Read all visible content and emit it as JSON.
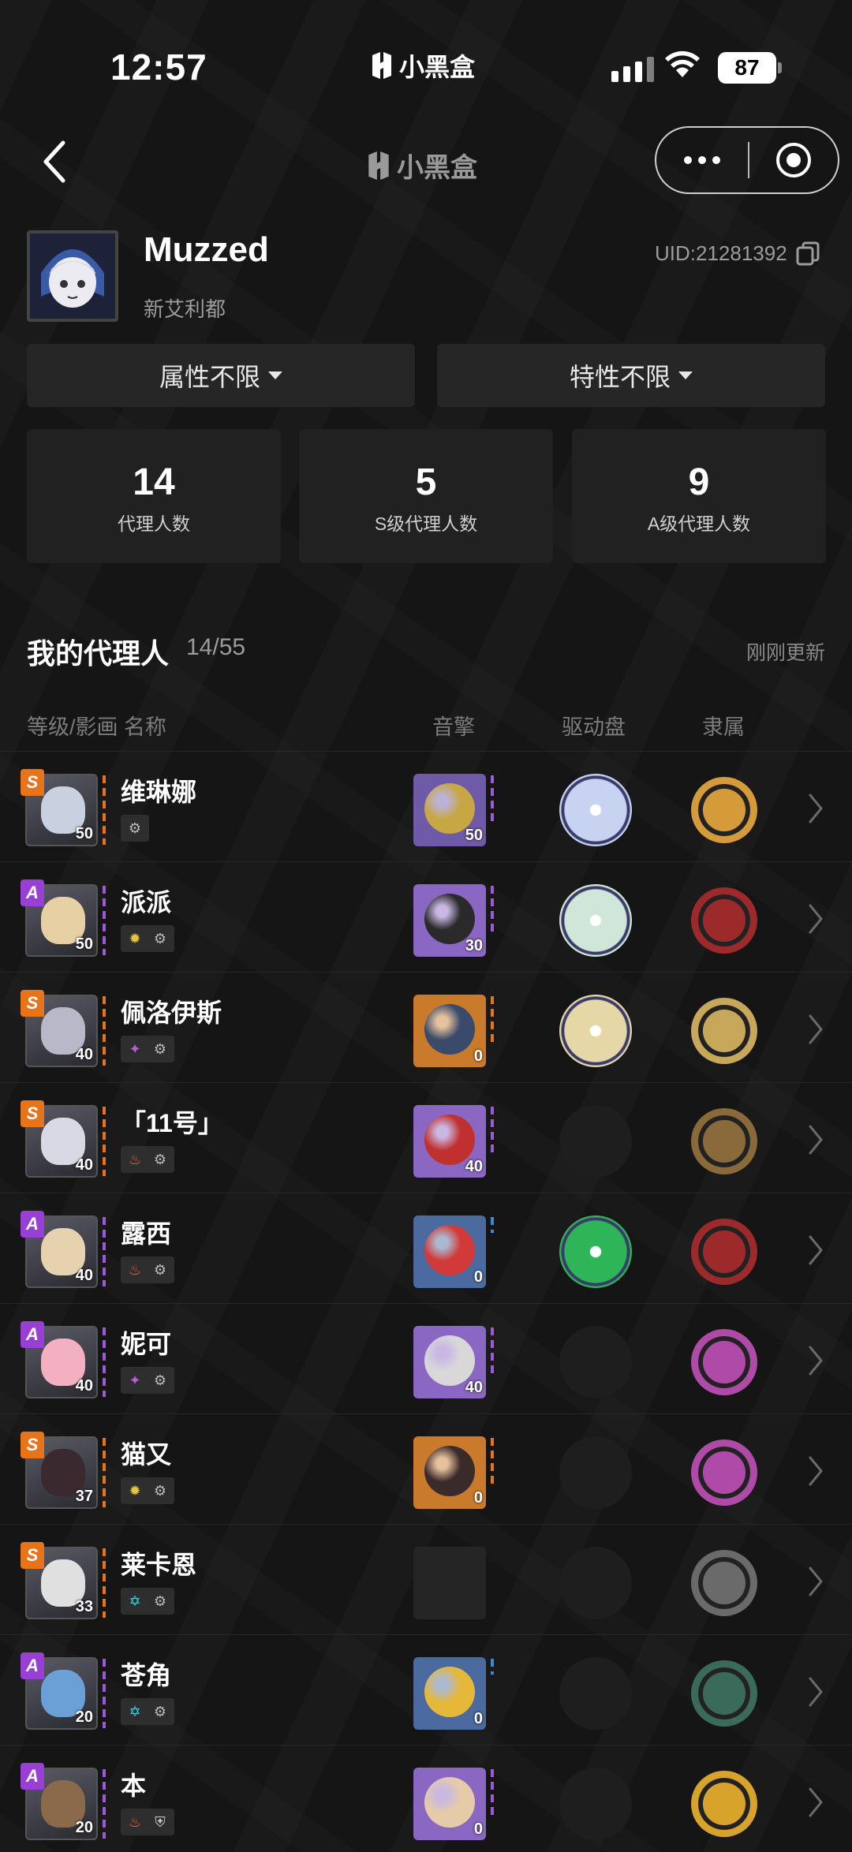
{
  "status": {
    "time": "12:57",
    "app_logo_text": "小黑盒",
    "battery": "87"
  },
  "nav": {
    "title": "小黑盒"
  },
  "profile": {
    "name": "Muzzed",
    "region": "新艾利都",
    "uid": "UID:21281392"
  },
  "filters": [
    {
      "label": "属性不限"
    },
    {
      "label": "特性不限"
    }
  ],
  "stats": [
    {
      "value": "14",
      "label": "代理人数"
    },
    {
      "value": "5",
      "label": "S级代理人数"
    },
    {
      "value": "9",
      "label": "A级代理人数"
    }
  ],
  "section": {
    "title": "我的代理人",
    "count": "14/55",
    "updated": "刚刚更新"
  },
  "columns": {
    "name": "等级/影画 名称",
    "engine": "音擎",
    "disc": "驱动盘",
    "faction": "隶属"
  },
  "agents": [
    {
      "rank": "S",
      "name": "维琳娜",
      "level": "50",
      "tags": [
        "phys-icon"
      ],
      "face": "#c9d0e0",
      "weapon": {
        "level": "50",
        "color": "#6f5aa8",
        "orb": "#c7a743"
      },
      "disc": "#c8d3f2",
      "faction": "#d59a3a"
    },
    {
      "rank": "A",
      "name": "派派",
      "level": "50",
      "tags": [
        "ice-icon",
        "phys-icon"
      ],
      "face": "#e6d0a4",
      "weapon": {
        "level": "30",
        "color": "#8a67c2",
        "orb": "#2a2a2a"
      },
      "disc": "#cfe6d8",
      "faction": "#9c2a2a"
    },
    {
      "rank": "S",
      "name": "佩洛伊斯",
      "level": "40",
      "tags": [
        "ether-icon",
        "phys-icon"
      ],
      "face": "#b8b8c8",
      "weapon": {
        "level": "0",
        "color": "#c97a2a",
        "orb": "#3a4a6a"
      },
      "disc": "#e6d7a6",
      "faction": "#c7a75a"
    },
    {
      "rank": "S",
      "name": "「11号」",
      "level": "40",
      "tags": [
        "fire-icon",
        "phys-icon"
      ],
      "face": "#d9d9e6",
      "weapon": {
        "level": "40",
        "color": "#8a67c2",
        "orb": "#c0302e"
      },
      "disc": "",
      "faction": "#8a6a3a"
    },
    {
      "rank": "A",
      "name": "露西",
      "level": "40",
      "tags": [
        "fire-icon",
        "phys-icon"
      ],
      "face": "#e7d2b0",
      "weapon": {
        "level": "0",
        "color": "#4a6aa0",
        "orb": "#d23a3a"
      },
      "disc": "#2db558",
      "faction": "#9c2a2a"
    },
    {
      "rank": "A",
      "name": "妮可",
      "level": "40",
      "tags": [
        "ether-icon",
        "phys-icon"
      ],
      "face": "#f2b0c0",
      "weapon": {
        "level": "40",
        "color": "#8a67c2",
        "orb": "#d8d8d8"
      },
      "disc": "",
      "faction": "#b04aa8"
    },
    {
      "rank": "S",
      "name": "猫又",
      "level": "37",
      "tags": [
        "ice-icon",
        "phys-icon"
      ],
      "face": "#3a2a30",
      "weapon": {
        "level": "0",
        "color": "#c97a2a",
        "orb": "#3a2a2a"
      },
      "disc": "",
      "faction": "#b04aa8"
    },
    {
      "rank": "S",
      "name": "莱卡恩",
      "level": "33",
      "tags": [
        "frost-icon",
        "phys-icon"
      ],
      "face": "#e0e0e0",
      "weapon": {
        "level": "",
        "color": "#252525",
        "orb": "#252525"
      },
      "disc": "",
      "faction": "#6a6a6a"
    },
    {
      "rank": "A",
      "name": "苍角",
      "level": "20",
      "tags": [
        "frost-icon",
        "phys-icon"
      ],
      "face": "#6aa0d6",
      "weapon": {
        "level": "0",
        "color": "#4a6aa0",
        "orb": "#e6b83a"
      },
      "disc": "",
      "faction": "#3a6a5a"
    },
    {
      "rank": "A",
      "name": "本",
      "level": "20",
      "tags": [
        "fire-icon",
        "shield-icon"
      ],
      "face": "#8a6a4a",
      "weapon": {
        "level": "0",
        "color": "#8a67c2",
        "orb": "#e6cba8"
      },
      "disc": "",
      "faction": "#d8a32a"
    }
  ]
}
